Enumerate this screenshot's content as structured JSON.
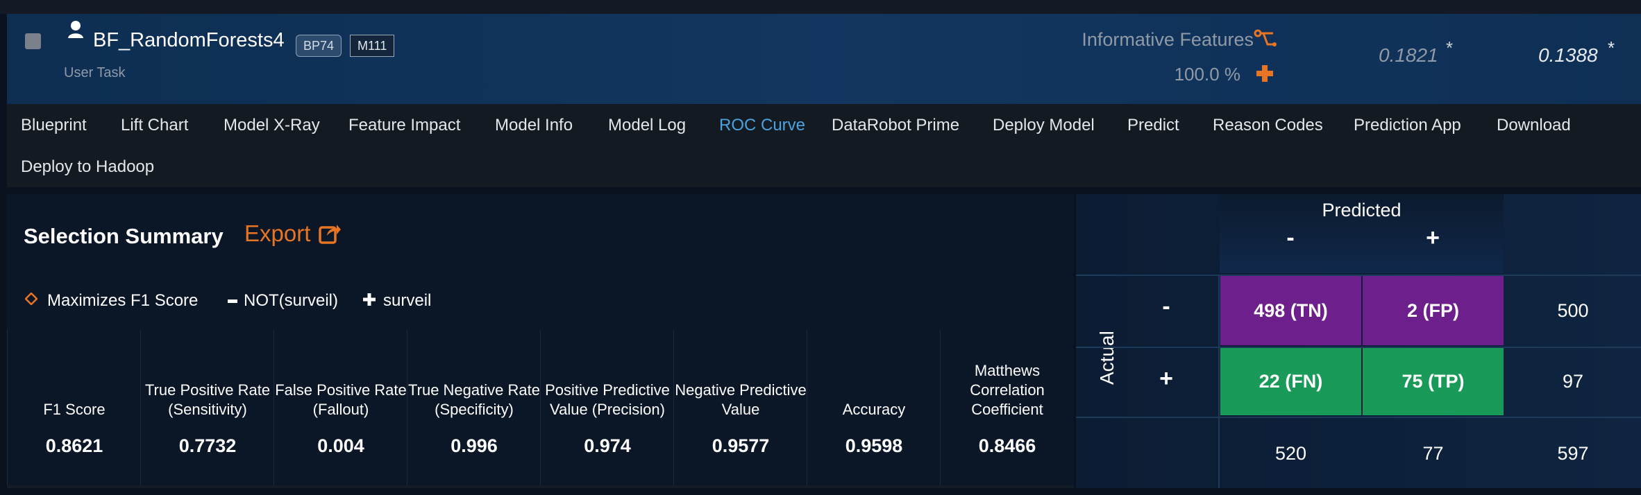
{
  "model": {
    "name": "BF_RandomForests4",
    "subtitle": "User Task",
    "badges": [
      "BP74",
      "M111"
    ],
    "informative_features_label": "Informative Features",
    "sample_pct": "100.0 %",
    "scores": [
      "0.1821",
      "0.1388"
    ],
    "score_marks": [
      "*",
      "*"
    ]
  },
  "tabs": [
    {
      "label": "Blueprint",
      "active": false
    },
    {
      "label": "Lift Chart",
      "active": false
    },
    {
      "label": "Model X-Ray",
      "active": false
    },
    {
      "label": "Feature Impact",
      "active": false
    },
    {
      "label": "Model Info",
      "active": false
    },
    {
      "label": "Model Log",
      "active": false
    },
    {
      "label": "ROC Curve",
      "active": true
    },
    {
      "label": "DataRobot Prime",
      "active": false
    },
    {
      "label": "Deploy Model",
      "active": false
    },
    {
      "label": "Predict",
      "active": false
    },
    {
      "label": "Reason Codes",
      "active": false
    },
    {
      "label": "Prediction App",
      "active": false
    },
    {
      "label": "Download",
      "active": false
    },
    {
      "label": "Deploy to Hadoop",
      "active": false
    }
  ],
  "summary": {
    "title": "Selection Summary",
    "export_label": "Export",
    "legend": {
      "maximizes": "Maximizes F1 Score",
      "negative": "NOT(surveil)",
      "positive": "surveil"
    },
    "metrics": [
      {
        "label": "F1 Score",
        "value": "0.8621"
      },
      {
        "label": "True Positive Rate (Sensitivity)",
        "value": "0.7732"
      },
      {
        "label": "False Positive Rate (Fallout)",
        "value": "0.004"
      },
      {
        "label": "True Negative Rate (Specificity)",
        "value": "0.996"
      },
      {
        "label": "Positive Predictive Value (Precision)",
        "value": "0.974"
      },
      {
        "label": "Negative Predictive Value",
        "value": "0.9577"
      },
      {
        "label": "Accuracy",
        "value": "0.9598"
      },
      {
        "label": "Matthews Correlation Coefficient",
        "value": "0.8466"
      }
    ]
  },
  "confusion_matrix": {
    "predicted_label": "Predicted",
    "actual_label": "Actual",
    "neg_sign": "-",
    "pos_sign": "+",
    "tn": "498 (TN)",
    "fp": "2 (FP)",
    "fn": "22 (FN)",
    "tp": "75 (TP)",
    "row_totals": [
      "500",
      "97"
    ],
    "col_totals": [
      "520",
      "77"
    ],
    "grand_total": "597"
  },
  "colors": {
    "accent_orange": "#e87524",
    "active_tab": "#4aa3e0",
    "tn_fp_cell": "#6d1f8c",
    "fn_tp_cell": "#1a9a59"
  }
}
